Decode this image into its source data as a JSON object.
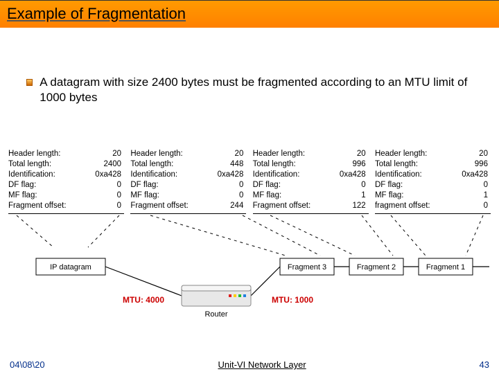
{
  "title": "Example of Fragmentation",
  "bullet": "A datagram with size 2400 bytes must be fragmented according to an MTU limit of 1000 bytes",
  "colLabels": {
    "hdr": "Header length:",
    "tot": "Total length:",
    "id": "Identification:",
    "df": "DF flag:",
    "mf": "MF flag:",
    "off": "Fragment offset:",
    "off_alt": "fragment offset:"
  },
  "cols": [
    {
      "hdr": "20",
      "tot": "2400",
      "id": "0xa428",
      "df": "0",
      "mf": "0",
      "off": "0"
    },
    {
      "hdr": "20",
      "tot": "448",
      "id": "0xa428",
      "df": "0",
      "mf": "0",
      "off": "244"
    },
    {
      "hdr": "20",
      "tot": "996",
      "id": "0xa428",
      "df": "0",
      "mf": "1",
      "off": "122"
    },
    {
      "hdr": "20",
      "tot": "996",
      "id": "0xa428",
      "df": "0",
      "mf": "1",
      "off": "0"
    }
  ],
  "svg": {
    "ip_datagram": "IP datagram",
    "frag3": "Fragment 3",
    "frag2": "Fragment 2",
    "frag1": "Fragment 1",
    "router": "Router",
    "mtu_left": "MTU: 4000",
    "mtu_right": "MTU: 1000"
  },
  "footer": {
    "left": "04\\08\\20",
    "mid_u": "Unit-VI",
    "mid_rest": " Network Layer",
    "page": "43"
  }
}
